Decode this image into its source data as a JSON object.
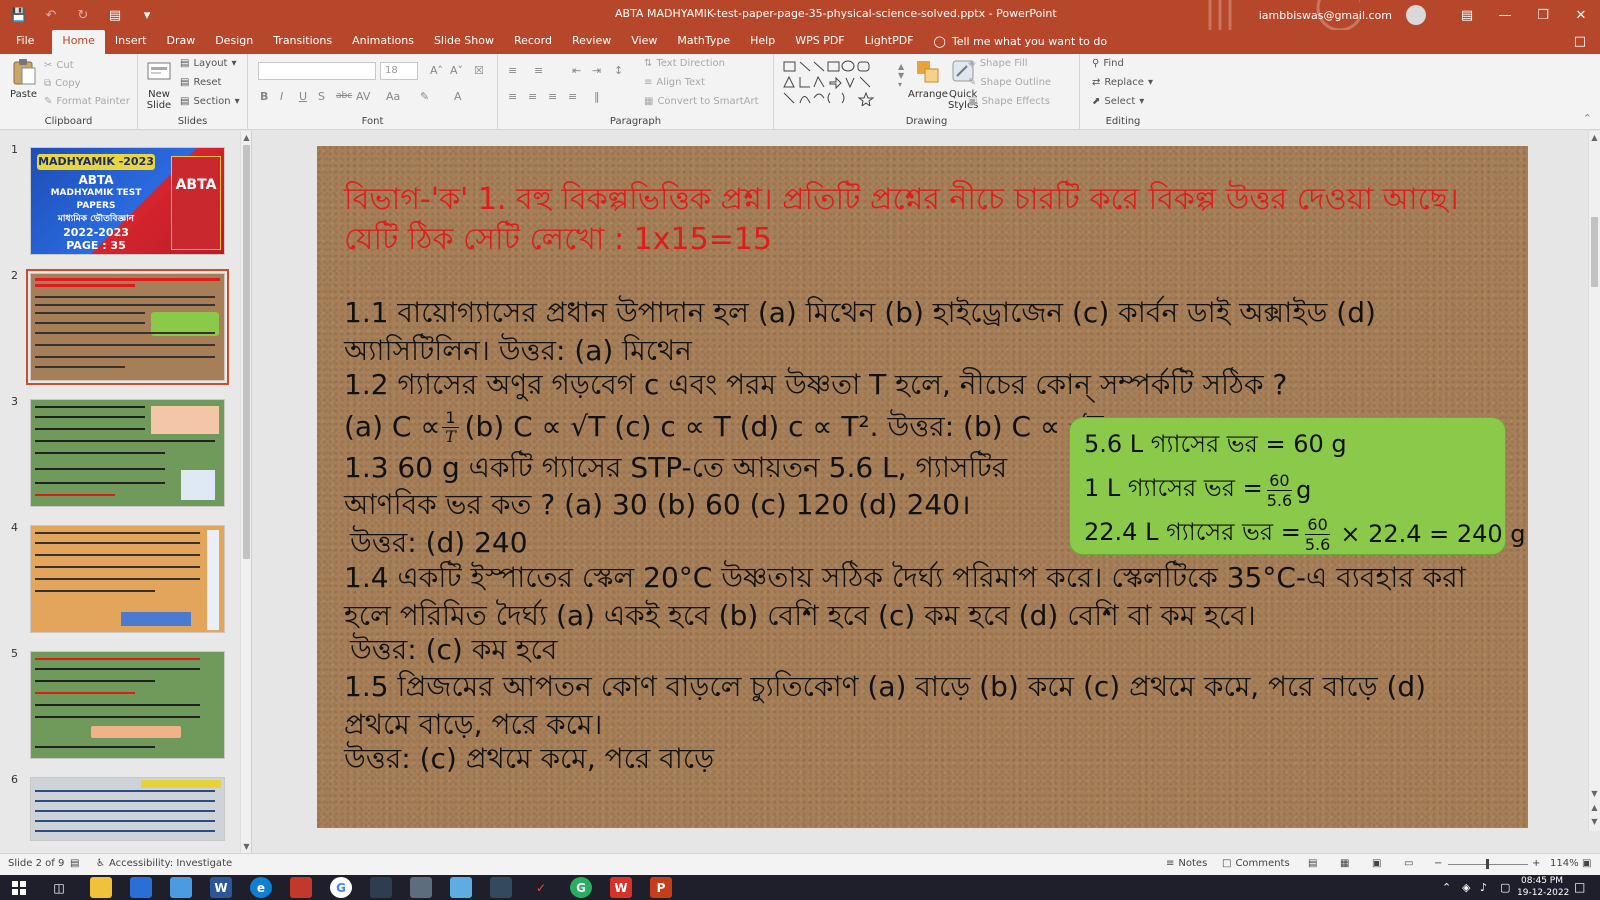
{
  "window": {
    "title": "ABTA MADHYAMIK-test-paper-page-35-physical-science-solved.pptx",
    "app_name": "PowerPoint",
    "account": "iambbiswas@gmail.com",
    "accent": "#b7472a"
  },
  "quick_access": [
    "save-icon",
    "undo-icon",
    "redo-icon",
    "start-from-beginning-icon",
    "customize-icon"
  ],
  "tabs": [
    {
      "label": "File"
    },
    {
      "label": "Home"
    },
    {
      "label": "Insert"
    },
    {
      "label": "Draw"
    },
    {
      "label": "Design"
    },
    {
      "label": "Transitions"
    },
    {
      "label": "Animations"
    },
    {
      "label": "Slide Show"
    },
    {
      "label": "Record"
    },
    {
      "label": "Review"
    },
    {
      "label": "View"
    },
    {
      "label": "MathType"
    },
    {
      "label": "Help"
    },
    {
      "label": "WPS PDF"
    },
    {
      "label": "LightPDF"
    }
  ],
  "tell_me": "Tell me what you want to do",
  "ribbon": {
    "clipboard": {
      "label": "Clipboard",
      "paste": "Paste",
      "cut": "Cut",
      "copy": "Copy",
      "format_painter": "Format Painter"
    },
    "slides": {
      "label": "Slides",
      "new_slide_1": "New",
      "new_slide_2": "Slide",
      "layout": "Layout",
      "reset": "Reset",
      "section": "Section"
    },
    "font": {
      "label": "Font",
      "size": "18"
    },
    "paragraph": {
      "label": "Paragraph",
      "text_direction": "Text Direction",
      "align_text": "Align Text",
      "smartart": "Convert to SmartArt"
    },
    "drawing": {
      "label": "Drawing",
      "arrange": "Arrange",
      "quick_styles_1": "Quick",
      "quick_styles_2": "Styles",
      "shape_fill": "Shape Fill",
      "shape_outline": "Shape Outline",
      "shape_effects": "Shape Effects"
    },
    "editing": {
      "label": "Editing",
      "find": "Find",
      "replace": "Replace",
      "select": "Select"
    }
  },
  "thumbnails": [
    {
      "num": "1",
      "title": "MADHYAMIK -2023",
      "lines": [
        "ABTA",
        "MADHYAMIK TEST PAPERS",
        "মাধ্যমিক ভৌতবিজ্ঞান",
        "2022-2023",
        "PAGE : 35"
      ],
      "side": "ABTA"
    },
    {
      "num": "2"
    },
    {
      "num": "3"
    },
    {
      "num": "4"
    },
    {
      "num": "5"
    },
    {
      "num": "6"
    }
  ],
  "slide": {
    "heading": "বিভাগ-'ক' 1. বহু বিকল্পভিত্তিক প্রশ্ন। প্রতিটি প্রশ্নের নীচে চারটি করে বিকল্প উত্তর দেওয়া আছে। যেটি ঠিক সেটি লেখো : 1x15=15",
    "q1": "1.1 বায়োগ্যাসের প্রধান উপাদান হল (a) মিথেন (b) হাইড্রোজেন (c) কার্বন ডাই অক্সাইড (d) অ্যাসিটিলিন। উত্তর: (a) মিথেন",
    "q2": "1.2 গ্যাসের অণুর গড়বেগ c এবং পরম উষ্ণতা T হলে, নীচের কোন্ সম্পর্কটি সঠিক ?",
    "q2_opt_a": "(a) C ∝",
    "q2_opt_bcd": "(b) C ∝ √T (c) c ∝ T (d) c ∝ T². উত্তর: (b) C ∝ √T",
    "q3_line1": "1.3 60 g একটি গ্যাসের STP-তে আয়তন 5.6 L, গ্যাসটির",
    "q3_line2": "আণবিক ভর কত ?  (a) 30  (b) 60 (c) 120 (d) 240।",
    "q3_answer": "উত্তর: (d) 240",
    "q4": "1.4 একটি ইস্পাতের স্কেল 20°C উষ্ণতায় সঠিক দৈর্ঘ্য পরিমাপ করে। স্কেলটিকে 35°C-এ ব্যবহার করা হলে পরিমিত দৈর্ঘ্য (a) একই হবে (b) বেশি হবে (c) কম হবে (d) বেশি বা কম হবে।",
    "q4_answer": "উত্তর: (c) কম হবে",
    "q5": "1.5 প্রিজমের আপতন কোণ বাড়লে চ্যুতিকোণ (a) বাড়ে (b) কমে (c) প্রথমে কমে, পরে বাড়ে (d) প্রথমে বাড়ে, পরে কমে।",
    "q5_answer": "উত্তর: (c) প্রথমে কমে, পরে বাড়ে",
    "box": {
      "line1": "5.6 L গ্যাসের ভর = 60 g",
      "line2_pre": "1 L গ্যাসের ভর =",
      "line2_num": "60",
      "line2_den": "5.6",
      "line2_post": "g",
      "line3_pre": "22.4 L গ্যাসের ভর =",
      "line3_num": "60",
      "line3_den": "5.6",
      "line3_post": "× 22.4 = 240 g"
    },
    "heading_color": "#e11b1b",
    "box_color": "#8bc94a"
  },
  "status": {
    "slide_count": "Slide 2 of 9",
    "accessibility": "Accessibility: Investigate",
    "notes": "Notes",
    "comments": "Comments",
    "zoom": "114%"
  },
  "taskbar": {
    "time": "08:45 PM",
    "date": "19-12-2022"
  }
}
